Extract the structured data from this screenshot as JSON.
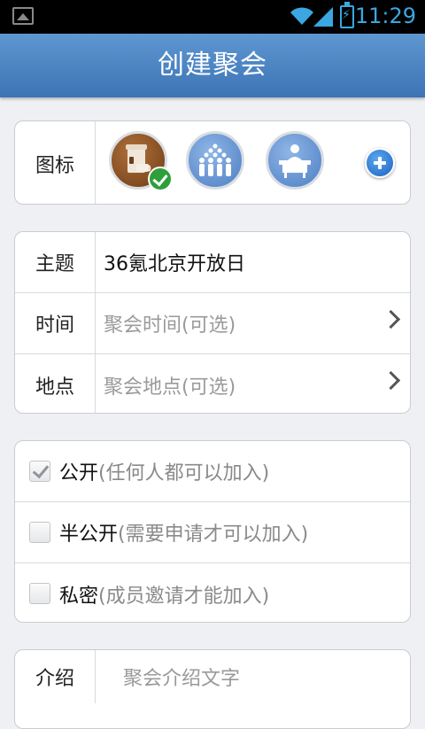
{
  "status_bar": {
    "time": "11:29"
  },
  "header": {
    "title": "创建聚会"
  },
  "icon_section": {
    "label": "图标",
    "icons": [
      {
        "name": "coffee-cup",
        "selected": true
      },
      {
        "name": "crowd"
      },
      {
        "name": "meeting-presenter"
      }
    ]
  },
  "info": {
    "topic_label": "主题",
    "topic_value": "36氪北京开放日",
    "time_label": "时间",
    "time_placeholder": "聚会时间(可选)",
    "place_label": "地点",
    "place_placeholder": "聚会地点(可选)"
  },
  "privacy": {
    "options": [
      {
        "label": "公开",
        "hint": "(任何人都可以加入)",
        "checked": true
      },
      {
        "label": "半公开",
        "hint": "(需要申请才可以加入)",
        "checked": false
      },
      {
        "label": "私密",
        "hint": "(成员邀请才能加入)",
        "checked": false
      }
    ]
  },
  "intro": {
    "label": "介绍",
    "placeholder": "聚会介绍文字"
  },
  "colors": {
    "header_gradient_top": "#5f97d2",
    "header_gradient_bottom": "#3c74b5",
    "status_accent": "#3aa7e2",
    "check_green": "#2e9f3a",
    "add_blue": "#1b62c2"
  }
}
